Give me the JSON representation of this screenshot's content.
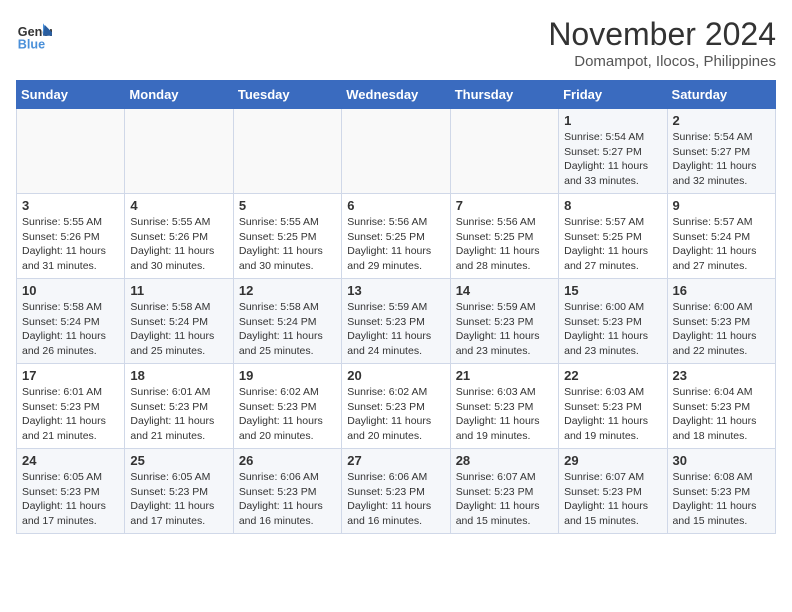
{
  "header": {
    "logo_line1": "General",
    "logo_line2": "Blue",
    "month_year": "November 2024",
    "location": "Domampot, Ilocos, Philippines"
  },
  "weekdays": [
    "Sunday",
    "Monday",
    "Tuesday",
    "Wednesday",
    "Thursday",
    "Friday",
    "Saturday"
  ],
  "weeks": [
    [
      {
        "day": "",
        "info": ""
      },
      {
        "day": "",
        "info": ""
      },
      {
        "day": "",
        "info": ""
      },
      {
        "day": "",
        "info": ""
      },
      {
        "day": "",
        "info": ""
      },
      {
        "day": "1",
        "info": "Sunrise: 5:54 AM\nSunset: 5:27 PM\nDaylight: 11 hours and 33 minutes."
      },
      {
        "day": "2",
        "info": "Sunrise: 5:54 AM\nSunset: 5:27 PM\nDaylight: 11 hours and 32 minutes."
      }
    ],
    [
      {
        "day": "3",
        "info": "Sunrise: 5:55 AM\nSunset: 5:26 PM\nDaylight: 11 hours and 31 minutes."
      },
      {
        "day": "4",
        "info": "Sunrise: 5:55 AM\nSunset: 5:26 PM\nDaylight: 11 hours and 30 minutes."
      },
      {
        "day": "5",
        "info": "Sunrise: 5:55 AM\nSunset: 5:25 PM\nDaylight: 11 hours and 30 minutes."
      },
      {
        "day": "6",
        "info": "Sunrise: 5:56 AM\nSunset: 5:25 PM\nDaylight: 11 hours and 29 minutes."
      },
      {
        "day": "7",
        "info": "Sunrise: 5:56 AM\nSunset: 5:25 PM\nDaylight: 11 hours and 28 minutes."
      },
      {
        "day": "8",
        "info": "Sunrise: 5:57 AM\nSunset: 5:25 PM\nDaylight: 11 hours and 27 minutes."
      },
      {
        "day": "9",
        "info": "Sunrise: 5:57 AM\nSunset: 5:24 PM\nDaylight: 11 hours and 27 minutes."
      }
    ],
    [
      {
        "day": "10",
        "info": "Sunrise: 5:58 AM\nSunset: 5:24 PM\nDaylight: 11 hours and 26 minutes."
      },
      {
        "day": "11",
        "info": "Sunrise: 5:58 AM\nSunset: 5:24 PM\nDaylight: 11 hours and 25 minutes."
      },
      {
        "day": "12",
        "info": "Sunrise: 5:58 AM\nSunset: 5:24 PM\nDaylight: 11 hours and 25 minutes."
      },
      {
        "day": "13",
        "info": "Sunrise: 5:59 AM\nSunset: 5:23 PM\nDaylight: 11 hours and 24 minutes."
      },
      {
        "day": "14",
        "info": "Sunrise: 5:59 AM\nSunset: 5:23 PM\nDaylight: 11 hours and 23 minutes."
      },
      {
        "day": "15",
        "info": "Sunrise: 6:00 AM\nSunset: 5:23 PM\nDaylight: 11 hours and 23 minutes."
      },
      {
        "day": "16",
        "info": "Sunrise: 6:00 AM\nSunset: 5:23 PM\nDaylight: 11 hours and 22 minutes."
      }
    ],
    [
      {
        "day": "17",
        "info": "Sunrise: 6:01 AM\nSunset: 5:23 PM\nDaylight: 11 hours and 21 minutes."
      },
      {
        "day": "18",
        "info": "Sunrise: 6:01 AM\nSunset: 5:23 PM\nDaylight: 11 hours and 21 minutes."
      },
      {
        "day": "19",
        "info": "Sunrise: 6:02 AM\nSunset: 5:23 PM\nDaylight: 11 hours and 20 minutes."
      },
      {
        "day": "20",
        "info": "Sunrise: 6:02 AM\nSunset: 5:23 PM\nDaylight: 11 hours and 20 minutes."
      },
      {
        "day": "21",
        "info": "Sunrise: 6:03 AM\nSunset: 5:23 PM\nDaylight: 11 hours and 19 minutes."
      },
      {
        "day": "22",
        "info": "Sunrise: 6:03 AM\nSunset: 5:23 PM\nDaylight: 11 hours and 19 minutes."
      },
      {
        "day": "23",
        "info": "Sunrise: 6:04 AM\nSunset: 5:23 PM\nDaylight: 11 hours and 18 minutes."
      }
    ],
    [
      {
        "day": "24",
        "info": "Sunrise: 6:05 AM\nSunset: 5:23 PM\nDaylight: 11 hours and 17 minutes."
      },
      {
        "day": "25",
        "info": "Sunrise: 6:05 AM\nSunset: 5:23 PM\nDaylight: 11 hours and 17 minutes."
      },
      {
        "day": "26",
        "info": "Sunrise: 6:06 AM\nSunset: 5:23 PM\nDaylight: 11 hours and 16 minutes."
      },
      {
        "day": "27",
        "info": "Sunrise: 6:06 AM\nSunset: 5:23 PM\nDaylight: 11 hours and 16 minutes."
      },
      {
        "day": "28",
        "info": "Sunrise: 6:07 AM\nSunset: 5:23 PM\nDaylight: 11 hours and 15 minutes."
      },
      {
        "day": "29",
        "info": "Sunrise: 6:07 AM\nSunset: 5:23 PM\nDaylight: 11 hours and 15 minutes."
      },
      {
        "day": "30",
        "info": "Sunrise: 6:08 AM\nSunset: 5:23 PM\nDaylight: 11 hours and 15 minutes."
      }
    ]
  ]
}
